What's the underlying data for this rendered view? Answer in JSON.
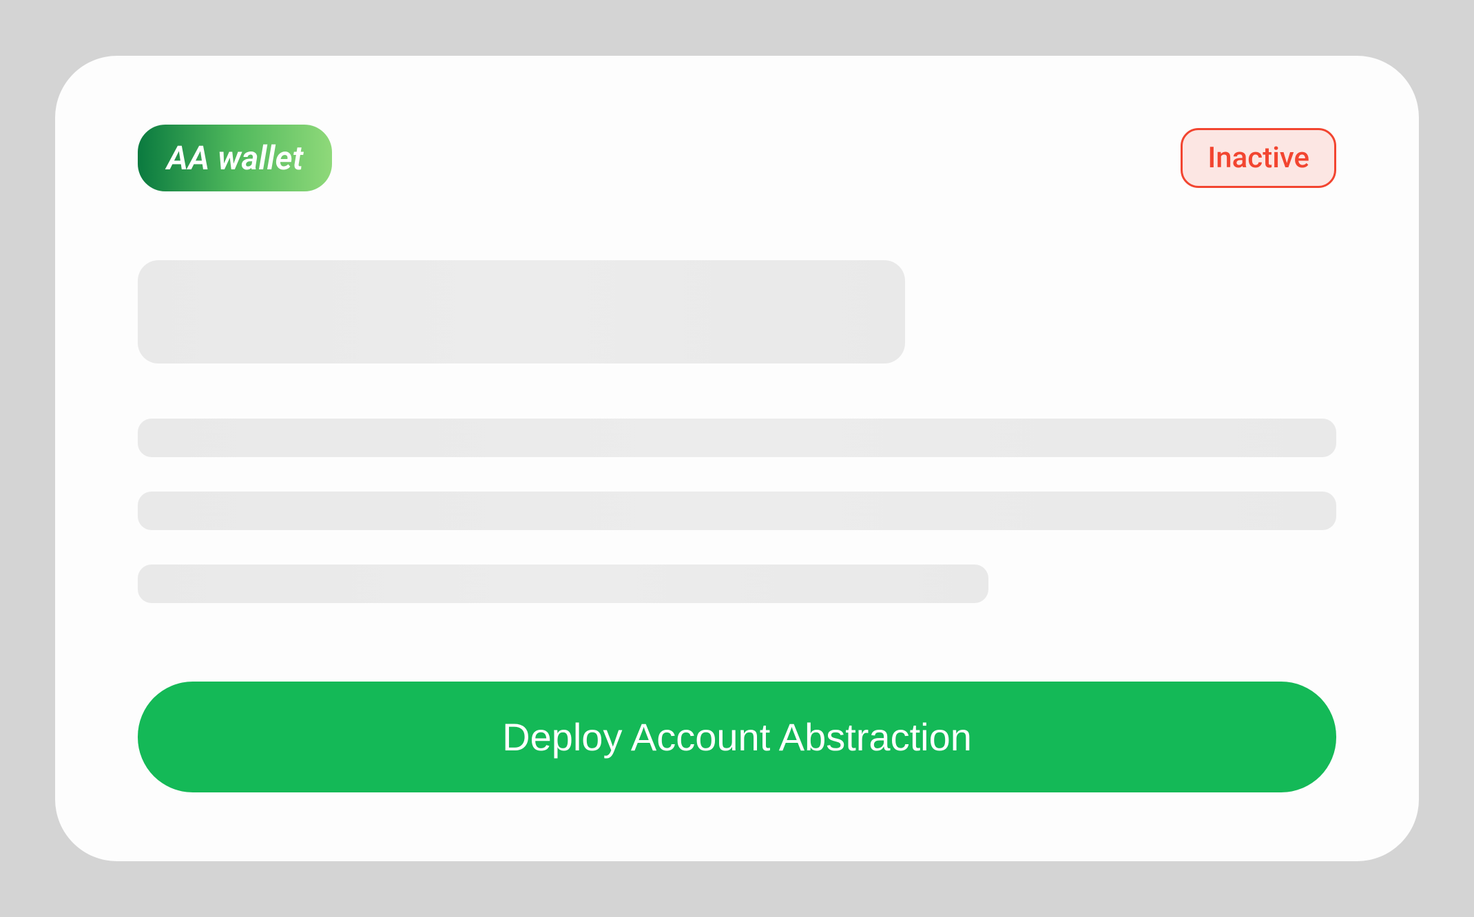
{
  "header": {
    "wallet_badge": "AA wallet",
    "status_badge": "Inactive"
  },
  "actions": {
    "deploy_button": "Deploy Account Abstraction"
  },
  "colors": {
    "card_bg": "#fdfdfd",
    "page_bg": "#d4d4d4",
    "wallet_gradient_start": "#0a7a3f",
    "wallet_gradient_end": "#8fd97a",
    "status_color": "#f24530",
    "status_bg": "#fce6e3",
    "button_bg": "#14b957",
    "skeleton_bg": "#e9e9e9"
  }
}
